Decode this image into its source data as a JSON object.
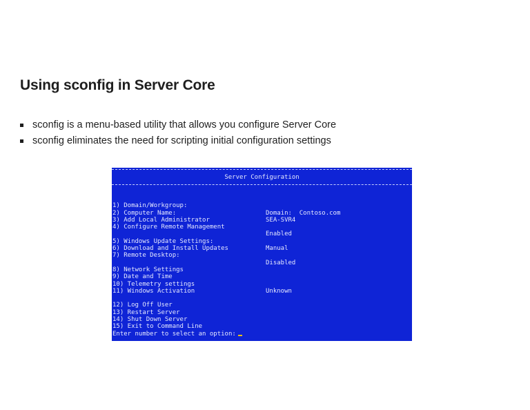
{
  "slide": {
    "title": "Using sconfig in Server Core",
    "bullets": [
      "sconfig is a menu-based utility that allows you configure Server Core",
      "sconfig eliminates the need for scripting  initial configuration settings"
    ]
  },
  "console": {
    "background_color": "#0f24d6",
    "header": "Server Configuration",
    "items": [
      {
        "label": "1) Domain/Workgroup:",
        "value": "Domain:  Contoso.com"
      },
      {
        "label": "2) Computer Name:",
        "value": "SEA-SVR4"
      },
      {
        "label": "3) Add Local Administrator",
        "value": ""
      },
      {
        "label": "4) Configure Remote Management",
        "value": "Enabled"
      },
      {
        "label": "5) Windows Update Settings:",
        "value": "Manual"
      },
      {
        "label": "6) Download and Install Updates",
        "value": ""
      },
      {
        "label": "7) Remote Desktop:",
        "value": "Disabled"
      },
      {
        "label": "8) Network Settings",
        "value": ""
      },
      {
        "label": "9) Date and Time",
        "value": ""
      },
      {
        "label": "10) Telemetry settings",
        "value": "Unknown"
      },
      {
        "label": "11) Windows Activation",
        "value": ""
      },
      {
        "label": "12) Log Off User",
        "value": ""
      },
      {
        "label": "13) Restart Server",
        "value": ""
      },
      {
        "label": "14) Shut Down Server",
        "value": ""
      },
      {
        "label": "15) Exit to Command Line",
        "value": ""
      }
    ],
    "prompt": "Enter number to select an option:"
  }
}
